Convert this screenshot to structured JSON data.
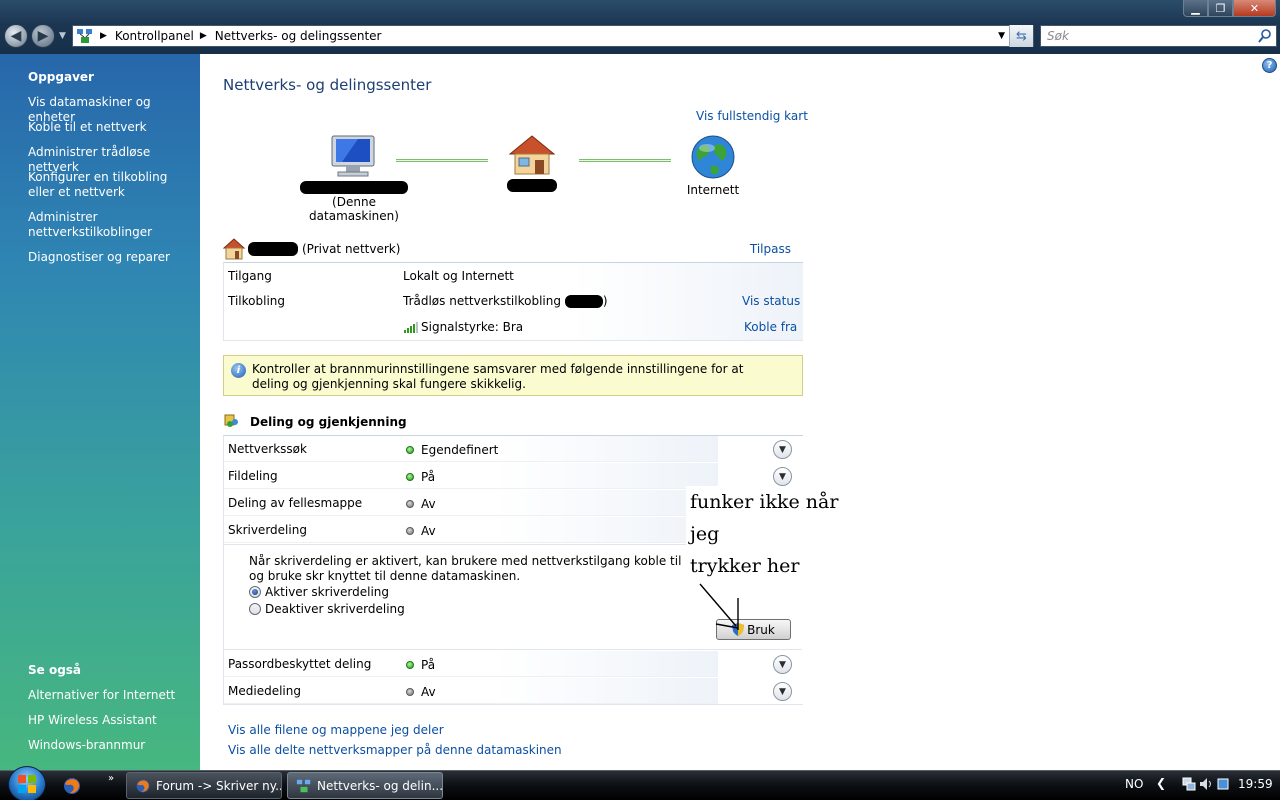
{
  "window": {
    "breadcrumbs": [
      "Kontrollpanel",
      "Nettverks- og delingssenter"
    ],
    "search_placeholder": "Søk"
  },
  "sidebar": {
    "tasks_heading": "Oppgaver",
    "tasks": [
      "Vis datamaskiner og enheter",
      "Koble til et nettverk",
      "Administrer trådløse nettverk",
      "Konfigurer en tilkobling eller et nettverk",
      "Administrer nettverkstilkoblinger",
      "Diagnostiser og reparer"
    ],
    "see_also_heading": "Se også",
    "see_also": [
      "Alternativer for Internett",
      "HP Wireless Assistant",
      "Windows-brannmur"
    ]
  },
  "main": {
    "title": "Nettverks- og delingssenter",
    "full_map_link": "Vis fullstendig kart",
    "map": {
      "computer_label": "(Denne datamaskinen)",
      "internet_label": "Internett"
    },
    "network": {
      "type_label": "(Privat nettverk)",
      "customize_link": "Tilpass",
      "rows": {
        "access_label": "Tilgang",
        "access_value": "Lokalt og Internett",
        "connection_label": "Tilkobling",
        "connection_value": "Trådløs nettverkstilkobling",
        "connection_suffix": ")",
        "signal_value": "Signalstyrke: Bra",
        "view_status_link": "Vis status",
        "disconnect_link": "Koble fra"
      }
    },
    "info_message": "Kontroller at brannmurinnstillingene samsvarer med følgende innstillingene for at deling og gjenkjenning skal fungere skikkelig.",
    "sharing": {
      "title": "Deling og gjenkjenning",
      "rows": [
        {
          "label": "Nettverkssøk",
          "status": "Egendefinert",
          "state": "on"
        },
        {
          "label": "Fildeling",
          "status": "På",
          "state": "on"
        },
        {
          "label": "Deling av fellesmappe",
          "status": "Av",
          "state": "off"
        },
        {
          "label": "Skriverdeling",
          "status": "Av",
          "state": "off"
        }
      ],
      "printer_detail": {
        "text": "Når skriverdeling er aktivert, kan brukere med nettverkstilgang koble til og bruke skr knyttet til denne datamaskinen.",
        "options": [
          "Aktiver skriverdeling",
          "Deaktiver skriverdeling"
        ],
        "apply_label": "Bruk"
      },
      "rows_after": [
        {
          "label": "Passordbeskyttet deling",
          "status": "På",
          "state": "on"
        },
        {
          "label": "Mediedeling",
          "status": "Av",
          "state": "off"
        }
      ]
    },
    "bottom_links": [
      "Vis alle filene og mappene jeg deler",
      "Vis alle delte nettverksmapper på denne datamaskinen"
    ],
    "annotation": {
      "line1": "funker ikke når jeg",
      "line2": "trykker her"
    }
  },
  "taskbar": {
    "buttons": [
      "Forum -> Skriver ny...",
      "Nettverks- og delin..."
    ],
    "language": "NO",
    "clock": "19:59"
  }
}
